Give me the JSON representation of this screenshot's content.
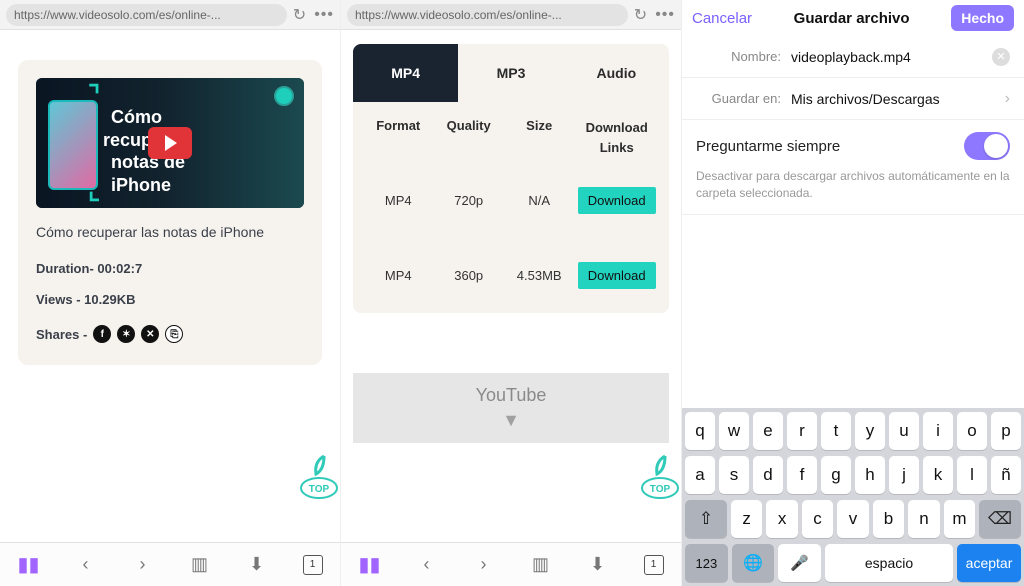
{
  "url": "https://www.videosolo.com/es/online-...",
  "video": {
    "overlay_line1": "Cómo",
    "overlay_line2": "recuperar",
    "overlay_line3": "notas de",
    "overlay_line4": "iPhone",
    "title": "Cómo recuperar las notas de iPhone",
    "duration_label": "Duration-  00:02:7",
    "views_label": "Views - 10.29KB",
    "shares_label": "Shares -"
  },
  "tabs_badge": "1",
  "dl": {
    "tab1": "MP4",
    "tab2": "MP3",
    "tab3": "Audio",
    "hdr_format": "Format",
    "hdr_quality": "Quality",
    "hdr_size": "Size",
    "hdr_links1": "Download",
    "hdr_links2": "Links",
    "rows": [
      {
        "format": "MP4",
        "quality": "720p",
        "size": "N/A",
        "btn": "Download"
      },
      {
        "format": "MP4",
        "quality": "360p",
        "size": "4.53MB",
        "btn": "Download"
      }
    ],
    "ytlabel": "YouTube"
  },
  "save": {
    "cancel": "Cancelar",
    "title": "Guardar archivo",
    "done": "Hecho",
    "name_label": "Nombre:",
    "name_value": "videoplayback.mp4",
    "loc_label": "Guardar en:",
    "loc_value": "Mis archivos/Descargas",
    "ask_label": "Preguntarme siempre",
    "hint": "Desactivar para descargar archivos automáticamente en la carpeta seleccionada."
  },
  "kb": {
    "row1": [
      "q",
      "w",
      "e",
      "r",
      "t",
      "y",
      "u",
      "i",
      "o",
      "p"
    ],
    "row2": [
      "a",
      "s",
      "d",
      "f",
      "g",
      "h",
      "j",
      "k",
      "l",
      "ñ"
    ],
    "row3": [
      "z",
      "x",
      "c",
      "v",
      "b",
      "n",
      "m"
    ],
    "num": "123",
    "space": "espacio",
    "accept": "aceptar"
  }
}
